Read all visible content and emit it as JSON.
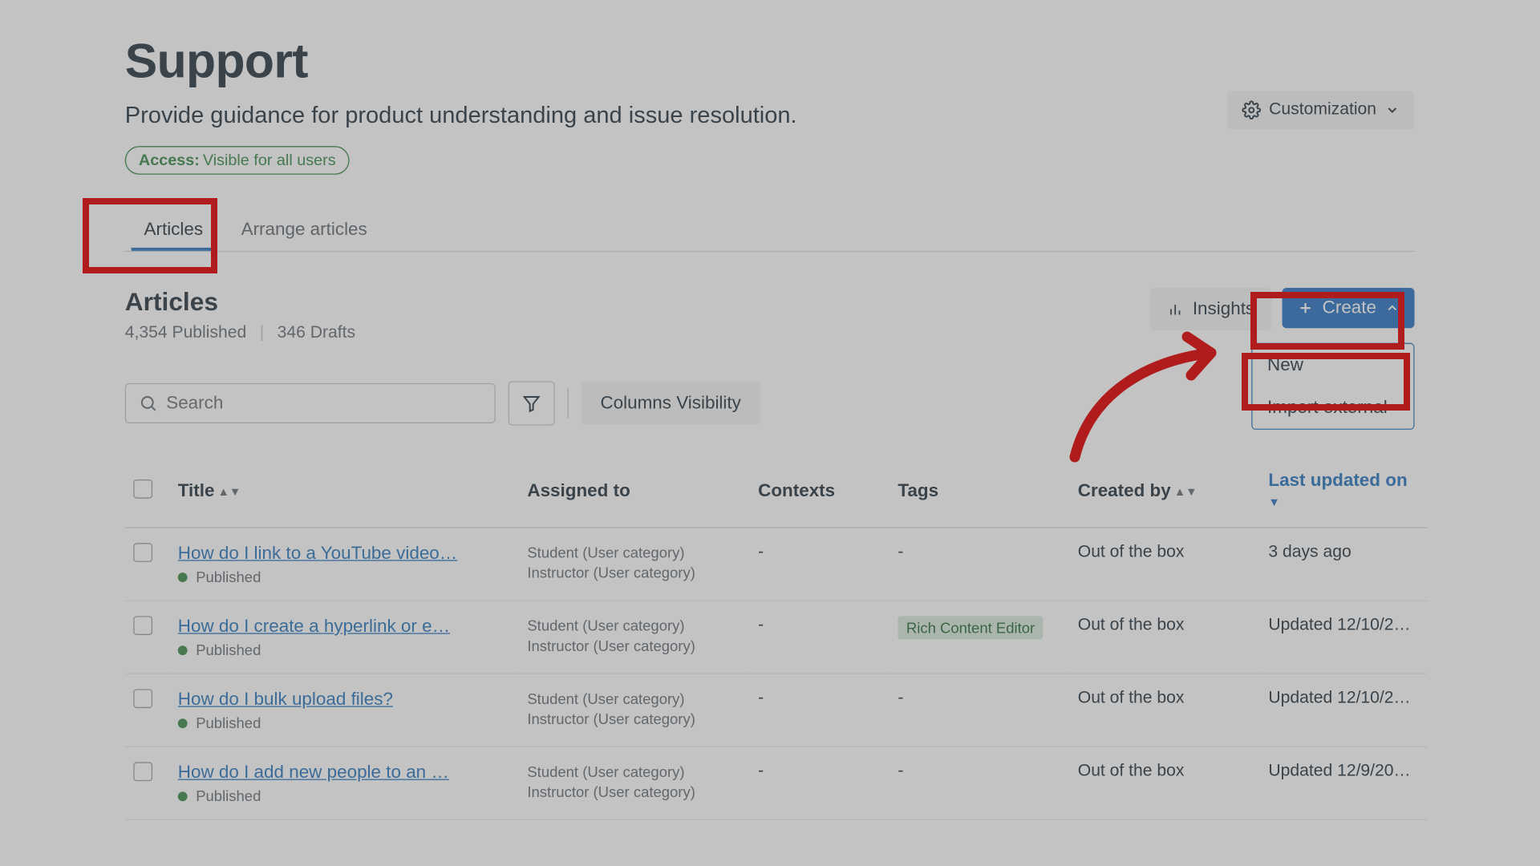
{
  "header": {
    "title": "Support",
    "subtitle": "Provide guidance for product understanding and issue resolution.",
    "customization_label": "Customization",
    "access_label": "Access:",
    "access_value": "Visible for all users"
  },
  "tabs": [
    {
      "label": "Articles",
      "active": true,
      "highlighted": true
    },
    {
      "label": "Arrange articles",
      "active": false,
      "highlighted": false
    }
  ],
  "section": {
    "title": "Articles",
    "published_count": "4,354 Published",
    "drafts_count": "346 Drafts",
    "insights_label": "Insights",
    "create_label": "Create",
    "dropdown": {
      "new": "New",
      "import": "Import external"
    }
  },
  "toolbar": {
    "search_placeholder": "Search",
    "columns_visibility": "Columns Visibility"
  },
  "columns": {
    "title": "Title",
    "assigned_to": "Assigned to",
    "contexts": "Contexts",
    "tags": "Tags",
    "created_by": "Created by",
    "last_updated": "Last updated on"
  },
  "common": {
    "published_status": "Published",
    "assigned": [
      "Student (User category)",
      "Instructor (User category)"
    ],
    "dash": "-",
    "created_by": "Out of the box"
  },
  "rows": [
    {
      "title": "How do I link to a YouTube video…",
      "tags": [],
      "updated": "3 days ago"
    },
    {
      "title": "How do I create a hyperlink or e…",
      "tags": [
        "Rich Content Editor"
      ],
      "updated": "Updated 12/10/2…"
    },
    {
      "title": "How do I bulk upload files?",
      "tags": [],
      "updated": "Updated 12/10/2…"
    },
    {
      "title": "How do I add new people to an …",
      "tags": [],
      "updated": "Updated 12/9/20…"
    }
  ],
  "annotation": {
    "color": "#b01c1c"
  }
}
